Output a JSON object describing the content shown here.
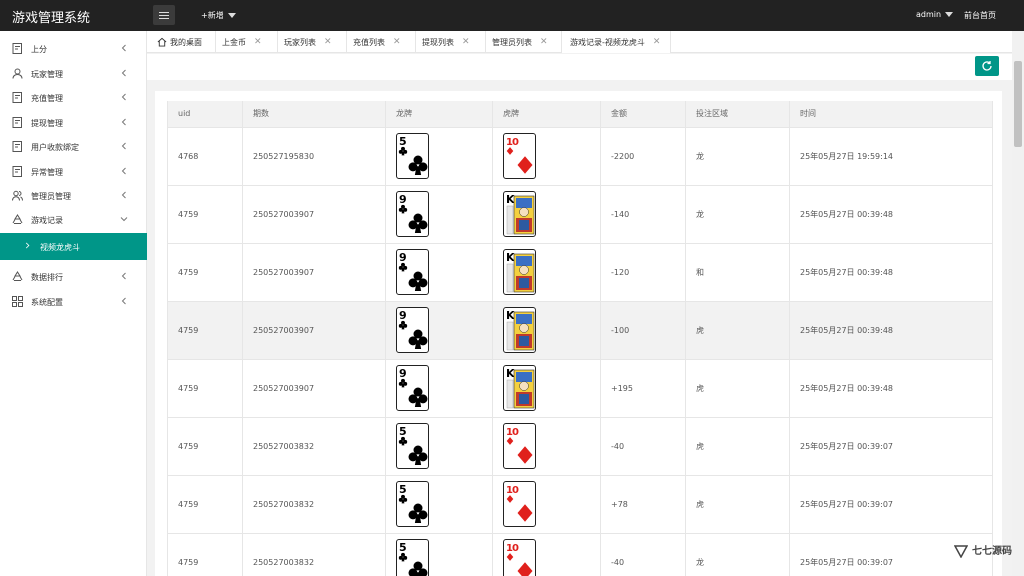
{
  "app": {
    "title": "游戏管理系统"
  },
  "header": {
    "new_label": "+新增",
    "user": "admin",
    "home_link": "前台首页"
  },
  "sidebar": {
    "items": [
      {
        "label": "上分",
        "icon": "doc-icon"
      },
      {
        "label": "玩家管理",
        "icon": "user-icon"
      },
      {
        "label": "充值管理",
        "icon": "doc-icon"
      },
      {
        "label": "提现管理",
        "icon": "doc-icon"
      },
      {
        "label": "用户收款绑定",
        "icon": "doc-icon"
      },
      {
        "label": "异常管理",
        "icon": "doc-icon"
      },
      {
        "label": "管理员管理",
        "icon": "users-icon"
      },
      {
        "label": "游戏记录",
        "icon": "recycle-icon"
      }
    ],
    "active_sub": "视频龙虎斗",
    "items_after": [
      {
        "label": "数据排行",
        "icon": "recycle-icon"
      },
      {
        "label": "系统配置",
        "icon": "grid-icon"
      }
    ]
  },
  "tabs": [
    {
      "label": "我的桌面",
      "icon": "home-icon"
    },
    {
      "label": "上金币"
    },
    {
      "label": "玩家列表"
    },
    {
      "label": "充值列表"
    },
    {
      "label": "提现列表"
    },
    {
      "label": "管理员列表"
    },
    {
      "label": "游戏记录-视频龙虎斗",
      "active": true
    }
  ],
  "table": {
    "columns": [
      "uid",
      "期数",
      "龙牌",
      "虎牌",
      "金额",
      "投注区域",
      "时间"
    ],
    "rows": [
      {
        "uid": "4768",
        "period": "250527195830",
        "dragon": {
          "rank": "5",
          "suit": "club"
        },
        "tiger": {
          "rank": "10",
          "suit": "diamond"
        },
        "amount": "-2200",
        "area": "龙",
        "time": "25年05月27日 19:59:14"
      },
      {
        "uid": "4759",
        "period": "250527003907",
        "dragon": {
          "rank": "9",
          "suit": "club"
        },
        "tiger": {
          "rank": "K",
          "suit": "king"
        },
        "amount": "-140",
        "area": "龙",
        "time": "25年05月27日 00:39:48"
      },
      {
        "uid": "4759",
        "period": "250527003907",
        "dragon": {
          "rank": "9",
          "suit": "club"
        },
        "tiger": {
          "rank": "K",
          "suit": "king"
        },
        "amount": "-120",
        "area": "和",
        "time": "25年05月27日 00:39:48"
      },
      {
        "uid": "4759",
        "period": "250527003907",
        "dragon": {
          "rank": "9",
          "suit": "club"
        },
        "tiger": {
          "rank": "K",
          "suit": "king"
        },
        "amount": "-100",
        "area": "虎",
        "time": "25年05月27日 00:39:48"
      },
      {
        "uid": "4759",
        "period": "250527003907",
        "dragon": {
          "rank": "9",
          "suit": "club"
        },
        "tiger": {
          "rank": "K",
          "suit": "king"
        },
        "amount": "+195",
        "area": "虎",
        "time": "25年05月27日 00:39:48"
      },
      {
        "uid": "4759",
        "period": "250527003832",
        "dragon": {
          "rank": "5",
          "suit": "club"
        },
        "tiger": {
          "rank": "10",
          "suit": "diamond"
        },
        "amount": "-40",
        "area": "虎",
        "time": "25年05月27日 00:39:07"
      },
      {
        "uid": "4759",
        "period": "250527003832",
        "dragon": {
          "rank": "5",
          "suit": "club"
        },
        "tiger": {
          "rank": "10",
          "suit": "diamond"
        },
        "amount": "+78",
        "area": "虎",
        "time": "25年05月27日 00:39:07"
      },
      {
        "uid": "4759",
        "period": "250527003832",
        "dragon": {
          "rank": "5",
          "suit": "club"
        },
        "tiger": {
          "rank": "10",
          "suit": "diamond"
        },
        "amount": "-40",
        "area": "龙",
        "time": "25年05月27日 00:39:07"
      }
    ]
  },
  "watermark": {
    "text": "七七源码"
  },
  "colors": {
    "accent": "#009688",
    "topbar": "#222222"
  }
}
